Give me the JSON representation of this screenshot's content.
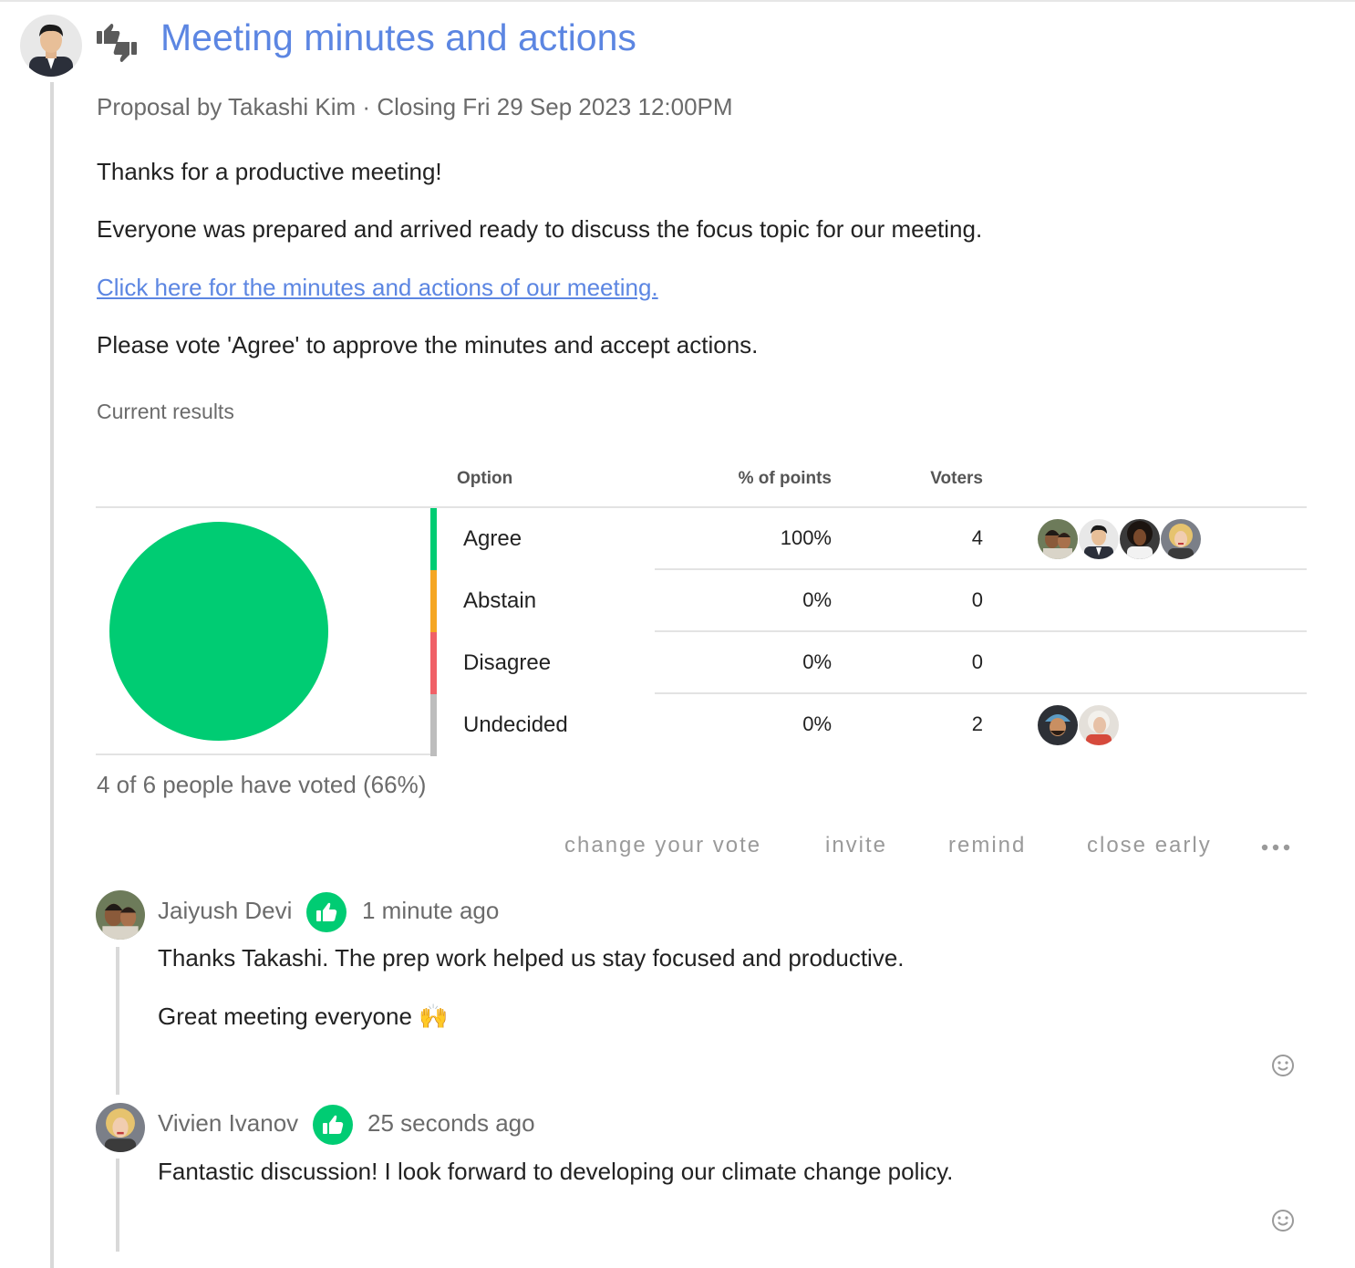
{
  "poll": {
    "title": "Meeting minutes and actions",
    "meta": "Proposal by Takashi Kim · Closing Fri 29 Sep 2023 12:00PM",
    "author_avatar": "takashi-kim-avatar",
    "type_icon": "thumbs-up-down-icon"
  },
  "body": {
    "p1": "Thanks for a productive meeting!",
    "p2": "Everyone was prepared and arrived ready to discuss the focus topic for our meeting.",
    "link": "Click here for the minutes and actions of our meeting.",
    "p3": "Please vote 'Agree' to approve the minutes and accept actions."
  },
  "results": {
    "label": "Current results",
    "headers": {
      "option": "Option",
      "percent": "% of points",
      "voters": "Voters"
    },
    "rows": [
      {
        "label": "Agree",
        "percent": "100%",
        "count": "4",
        "color": "#00cc73",
        "voters": [
          "jaiyush-devi-avatar",
          "takashi-kim-avatar",
          "voter-3-avatar",
          "vivien-ivanov-avatar"
        ]
      },
      {
        "label": "Abstain",
        "percent": "0%",
        "count": "0",
        "color": "#f5a623",
        "voters": []
      },
      {
        "label": "Disagree",
        "percent": "0%",
        "count": "0",
        "color": "#f06067",
        "voters": []
      },
      {
        "label": "Undecided",
        "percent": "0%",
        "count": "2",
        "color": "#bdbdbd",
        "voters": [
          "voter-5-avatar",
          "voter-6-avatar"
        ]
      }
    ],
    "voted_summary": "4 of 6 people have voted (66%)"
  },
  "chart_data": {
    "type": "pie",
    "categories": [
      "Agree",
      "Abstain",
      "Disagree",
      "Undecided"
    ],
    "values": [
      100,
      0,
      0,
      0
    ],
    "colors": [
      "#00cc73",
      "#f5a623",
      "#f06067",
      "#bdbdbd"
    ]
  },
  "actions": {
    "change_vote": "change your vote",
    "invite": "invite",
    "remind": "remind",
    "close_early": "close early",
    "more_icon": "more-horizontal-icon"
  },
  "comments": [
    {
      "name": "Jaiyush Devi",
      "time": "1 minute ago",
      "vote": "Agree",
      "lines": [
        "Thanks Takashi. The prep work helped us stay focused and productive.",
        "Great meeting everyone 🙌"
      ]
    },
    {
      "name": "Vivien Ivanov",
      "time": "25 seconds ago",
      "vote": "Agree",
      "lines": [
        "Fantastic discussion! I look forward to developing our climate change policy."
      ]
    }
  ],
  "colors": {
    "accent": "#5c86e2",
    "agree": "#00cc73",
    "muted": "#6b6b6b"
  }
}
